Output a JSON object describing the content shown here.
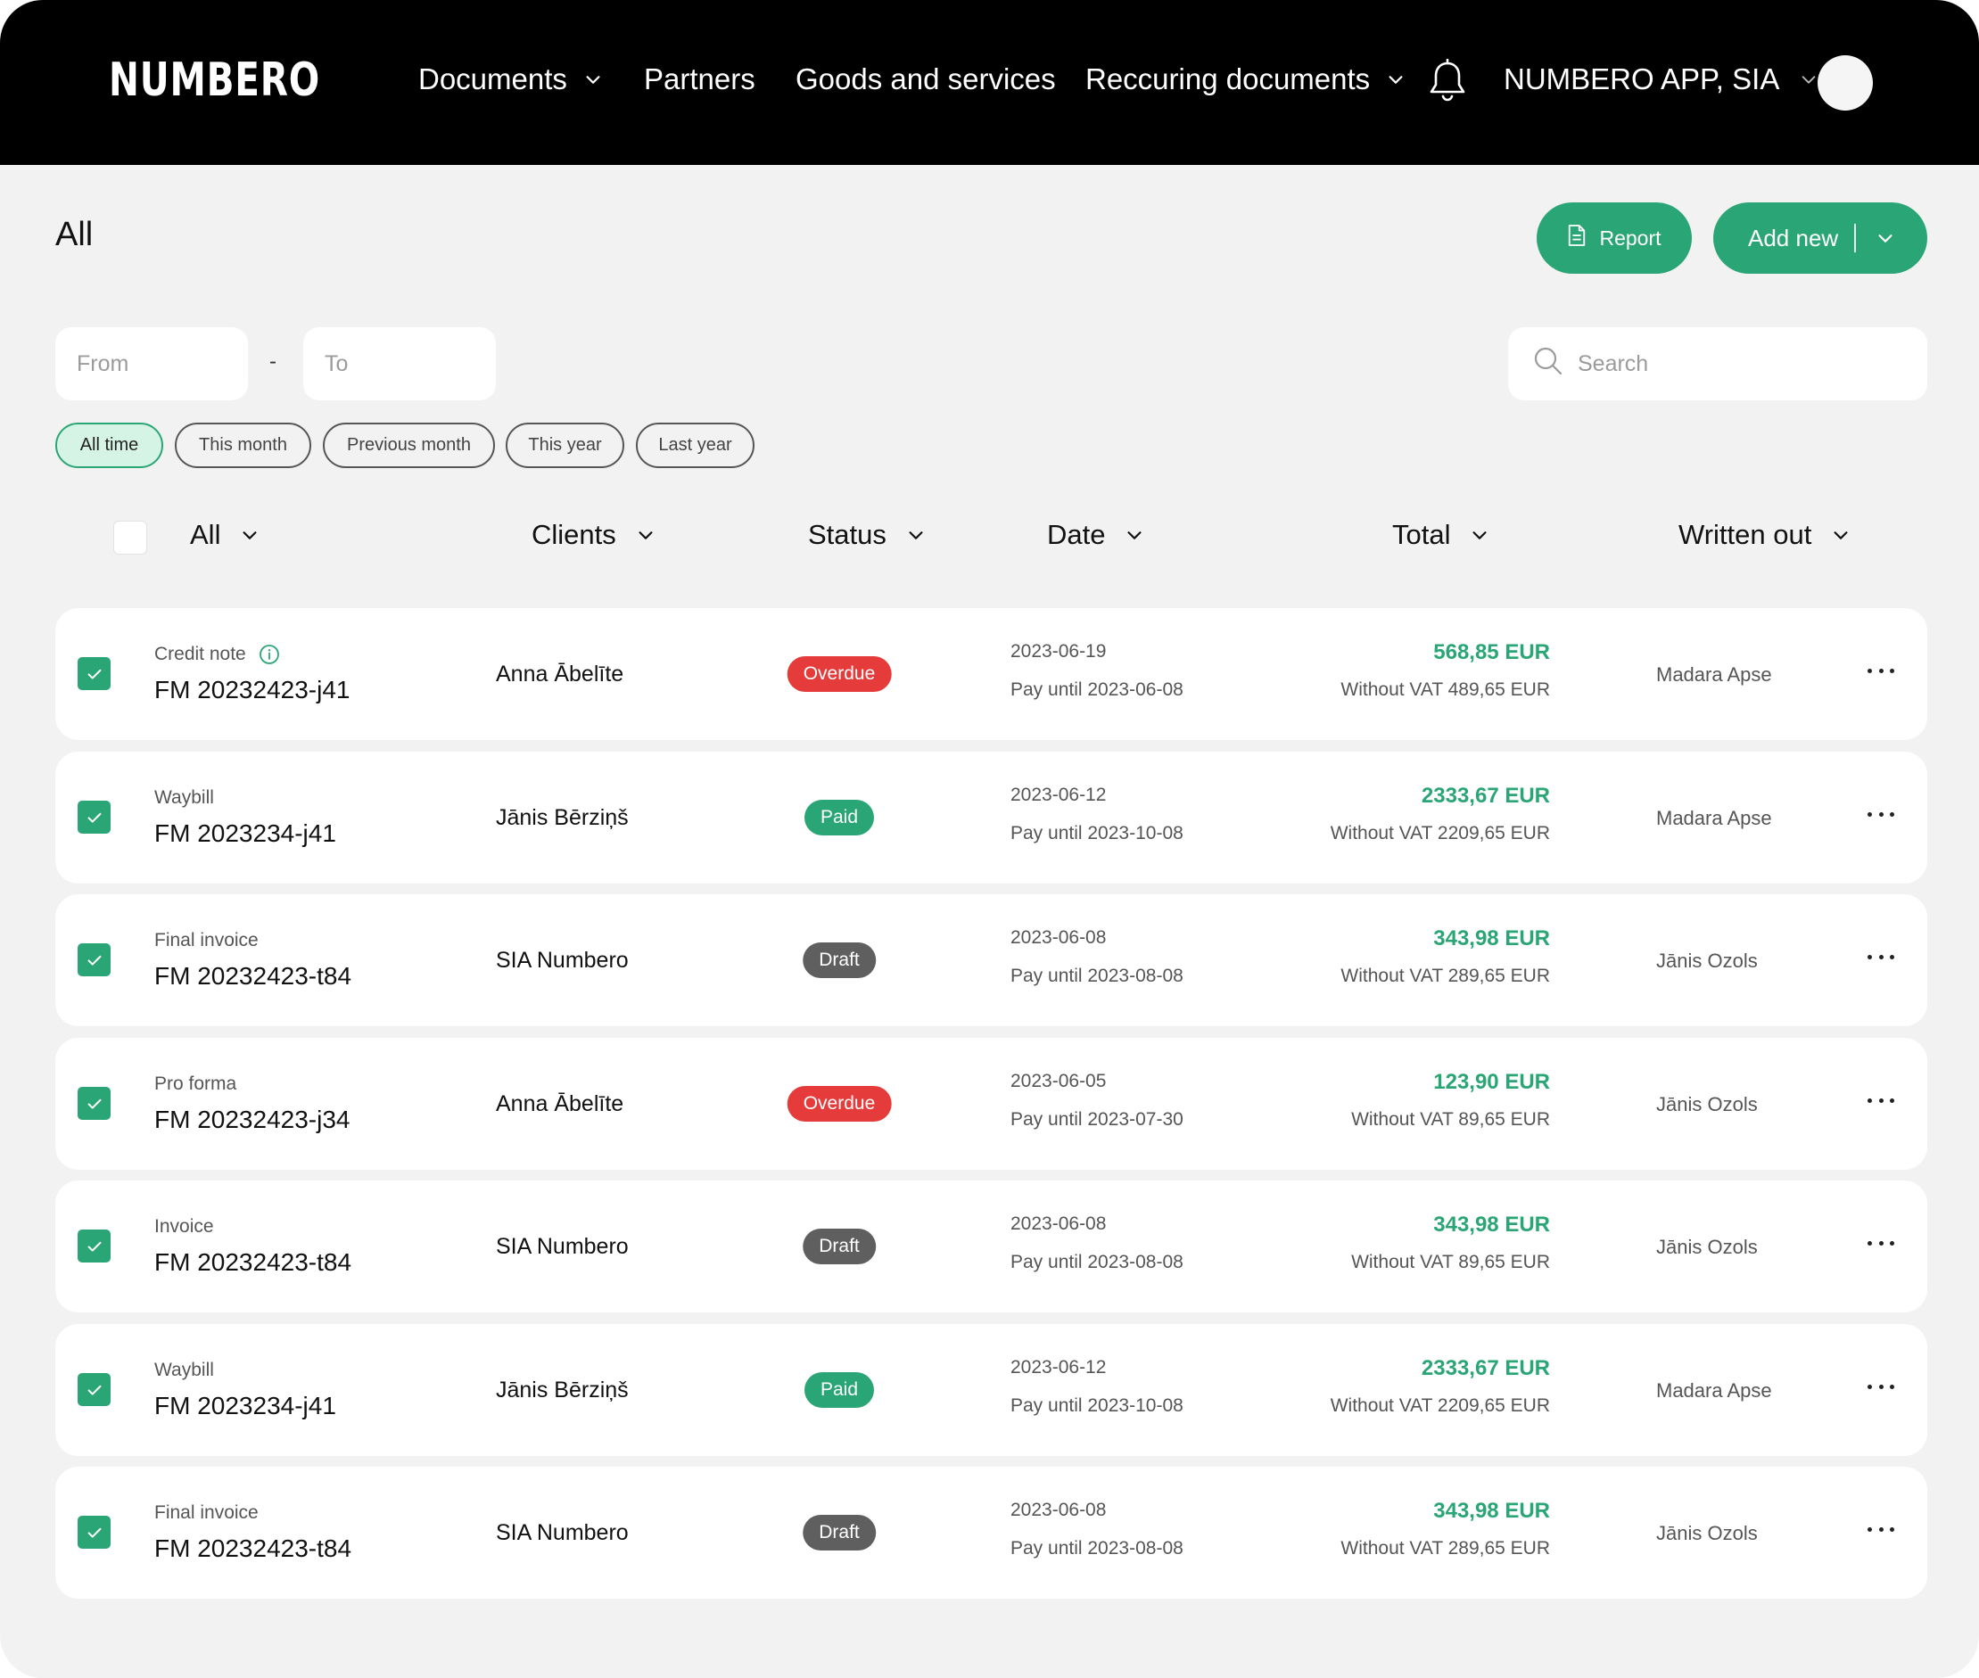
{
  "nav": {
    "logo": "NUMBERO",
    "items": [
      {
        "label": "Documents",
        "dropdown": true
      },
      {
        "label": "Partners",
        "dropdown": false
      },
      {
        "label": "Goods and services",
        "dropdown": false
      },
      {
        "label": "Reccuring documents",
        "dropdown": true
      }
    ],
    "company": "NUMBERO APP, SIA"
  },
  "page": {
    "title": "All",
    "report_label": "Report",
    "add_new_label": "Add new"
  },
  "filters": {
    "from_placeholder": "From",
    "separator": "-",
    "to_placeholder": "To",
    "search_placeholder": "Search",
    "chips": [
      "All time",
      "This month",
      "Previous month",
      "This year",
      "Last year"
    ],
    "active_chip": "All time"
  },
  "table": {
    "headers": {
      "all": "All",
      "clients": "Clients",
      "status": "Status",
      "date": "Date",
      "total": "Total",
      "written_out": "Written out"
    },
    "rows": [
      {
        "type": "Credit note",
        "info": true,
        "number": "FM 20232423-j41",
        "client": "Anna Ābelīte",
        "status": "Overdue",
        "status_kind": "overdue",
        "date": "2023-06-19",
        "pay_until": "Pay until  2023-06-08",
        "total": "568,85 EUR",
        "without_vat": "Without VAT 489,65 EUR",
        "written_out": "Madara Apse"
      },
      {
        "type": "Waybill",
        "info": false,
        "number": "FM 2023234-j41",
        "client": "Jānis Bērziņš",
        "status": "Paid",
        "status_kind": "paid",
        "date": "2023-06-12",
        "pay_until": "Pay until 2023-10-08",
        "total": "2333,67 EUR",
        "without_vat": "Without VAT 2209,65 EUR",
        "written_out": "Madara Apse"
      },
      {
        "type": "Final invoice",
        "info": false,
        "number": "FM 20232423-t84",
        "client": "SIA Numbero",
        "status": "Draft",
        "status_kind": "draft",
        "date": "2023-06-08",
        "pay_until": "Pay until  2023-08-08",
        "total": "343,98 EUR",
        "without_vat": "Without VAT 289,65 EUR",
        "written_out": "Jānis Ozols"
      },
      {
        "type": "Pro forma",
        "info": false,
        "number": "FM 20232423-j34",
        "client": "Anna Ābelīte",
        "status": "Overdue",
        "status_kind": "overdue",
        "date": "2023-06-05",
        "pay_until": "Pay until  2023-07-30",
        "total": "123,90 EUR",
        "without_vat": "Without VAT 89,65 EUR",
        "written_out": "Jānis Ozols"
      },
      {
        "type": "Invoice",
        "info": false,
        "number": "FM 20232423-t84",
        "client": "SIA Numbero",
        "status": "Draft",
        "status_kind": "draft",
        "date": "2023-06-08",
        "pay_until": "Pay until  2023-08-08",
        "total": "343,98 EUR",
        "without_vat": "Without VAT 89,65 EUR",
        "written_out": "Jānis Ozols"
      },
      {
        "type": "Waybill",
        "info": false,
        "number": "FM 2023234-j41",
        "client": "Jānis Bērziņš",
        "status": "Paid",
        "status_kind": "paid",
        "date": "2023-06-12",
        "pay_until": "Pay until 2023-10-08",
        "total": "2333,67 EUR",
        "without_vat": "Without VAT 2209,65 EUR",
        "written_out": "Madara Apse"
      },
      {
        "type": "Final invoice",
        "info": false,
        "number": "FM 20232423-t84",
        "client": "SIA Numbero",
        "status": "Draft",
        "status_kind": "draft",
        "date": "2023-06-08",
        "pay_until": "Pay until  2023-08-08",
        "total": "343,98 EUR",
        "without_vat": "Without VAT 289,65 EUR",
        "written_out": "Jānis Ozols"
      }
    ]
  },
  "colors": {
    "brand_green": "#2aa676",
    "overdue_red": "#e53b3b",
    "draft_gray": "#5f5f5f",
    "navbar_bg": "#000000",
    "page_bg": "#f2f2f2"
  },
  "icons": [
    "bell-icon",
    "chevron-down-icon",
    "document-icon",
    "search-icon",
    "info-icon",
    "check-icon",
    "more-icon"
  ]
}
